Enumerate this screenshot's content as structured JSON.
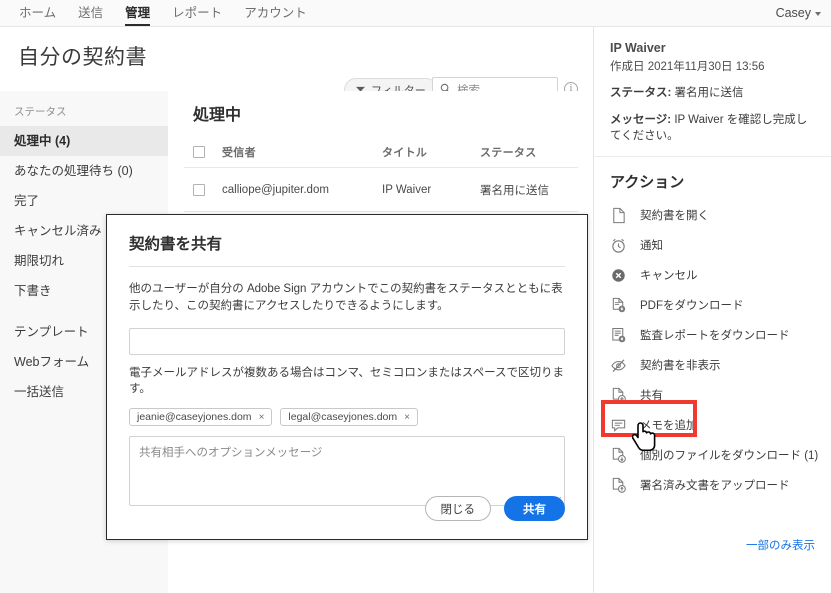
{
  "topnav": {
    "items": [
      {
        "label": "ホーム",
        "active": false
      },
      {
        "label": "送信",
        "active": false
      },
      {
        "label": "管理",
        "active": true
      },
      {
        "label": "レポート",
        "active": false
      },
      {
        "label": "アカウント",
        "active": false
      }
    ],
    "user": "Casey"
  },
  "page": {
    "title": "自分の契約書",
    "filter_label": "フィルター",
    "search_placeholder": "検索",
    "info_glyph": "i"
  },
  "sidebar": {
    "status_label": "ステータス",
    "items": [
      {
        "label": "処理中 (4)",
        "selected": true
      },
      {
        "label": "あなたの処理待ち (0)",
        "selected": false
      },
      {
        "label": "完了",
        "selected": false
      },
      {
        "label": "キャンセル済み",
        "selected": false
      },
      {
        "label": "期限切れ",
        "selected": false
      },
      {
        "label": "下書き",
        "selected": false
      }
    ],
    "items2": [
      {
        "label": "テンプレート"
      },
      {
        "label": "Webフォーム"
      },
      {
        "label": "一括送信"
      }
    ]
  },
  "list": {
    "title": "処理中",
    "columns": {
      "recipient": "受信者",
      "title": "タイトル",
      "status": "ステータス"
    },
    "rows": [
      {
        "recipient": "calliope@jupiter.dom",
        "title": "IP Waiver",
        "status": "署名用に送信"
      }
    ]
  },
  "rightpanel": {
    "doc_name": "IP Waiver",
    "created": "作成日 2021年11月30日 13:56",
    "status_label": "ステータス:",
    "status_value": "署名用に送信",
    "message_label": "メッセージ:",
    "message_value": "IP Waiver を確認し完成してください。",
    "actions_heading": "アクション",
    "actions": [
      {
        "label": "契約書を開く",
        "icon": "document-icon",
        "highlighted": false
      },
      {
        "label": "通知",
        "icon": "alarm-clock-icon",
        "highlighted": false
      },
      {
        "label": "キャンセル",
        "icon": "cancel-circle-icon",
        "highlighted": false
      },
      {
        "label": "PDFをダウンロード",
        "icon": "pdf-download-icon",
        "highlighted": false
      },
      {
        "label": "監査レポートをダウンロード",
        "icon": "audit-report-download-icon",
        "highlighted": false
      },
      {
        "label": "契約書を非表示",
        "icon": "eye-off-icon",
        "highlighted": false
      },
      {
        "label": "共有",
        "icon": "share-document-icon",
        "highlighted": true
      },
      {
        "label": "メモを追加",
        "icon": "note-icon",
        "highlighted": false
      },
      {
        "label": "個別のファイルをダウンロード (1)",
        "icon": "file-download-icon",
        "highlighted": false
      },
      {
        "label": "署名済み文書をアップロード",
        "icon": "file-upload-icon",
        "highlighted": false
      }
    ],
    "show_less": "一部のみ表示"
  },
  "modal": {
    "title": "契約書を共有",
    "description": "他のユーザーが自分の Adobe Sign アカウントでこの契約書をステータスとともに表示したり、この契約書にアクセスしたりできるようにします。",
    "email_value": "",
    "hint": "電子メールアドレスが複数ある場合はコンマ、セミコロンまたはスペースで区切ります。",
    "chips": [
      "jeanie@caseyjones.dom",
      "legal@caseyjones.dom"
    ],
    "chip_remove": "×",
    "message_placeholder": "共有相手へのオプションメッセージ",
    "message_value": "",
    "close_label": "閉じる",
    "share_label": "共有"
  },
  "colors": {
    "accent_blue": "#1473e6",
    "highlight_red": "#f03a2f",
    "sidebar_bg": "#f8f8f8",
    "selected_bg": "#e9e9e9"
  }
}
